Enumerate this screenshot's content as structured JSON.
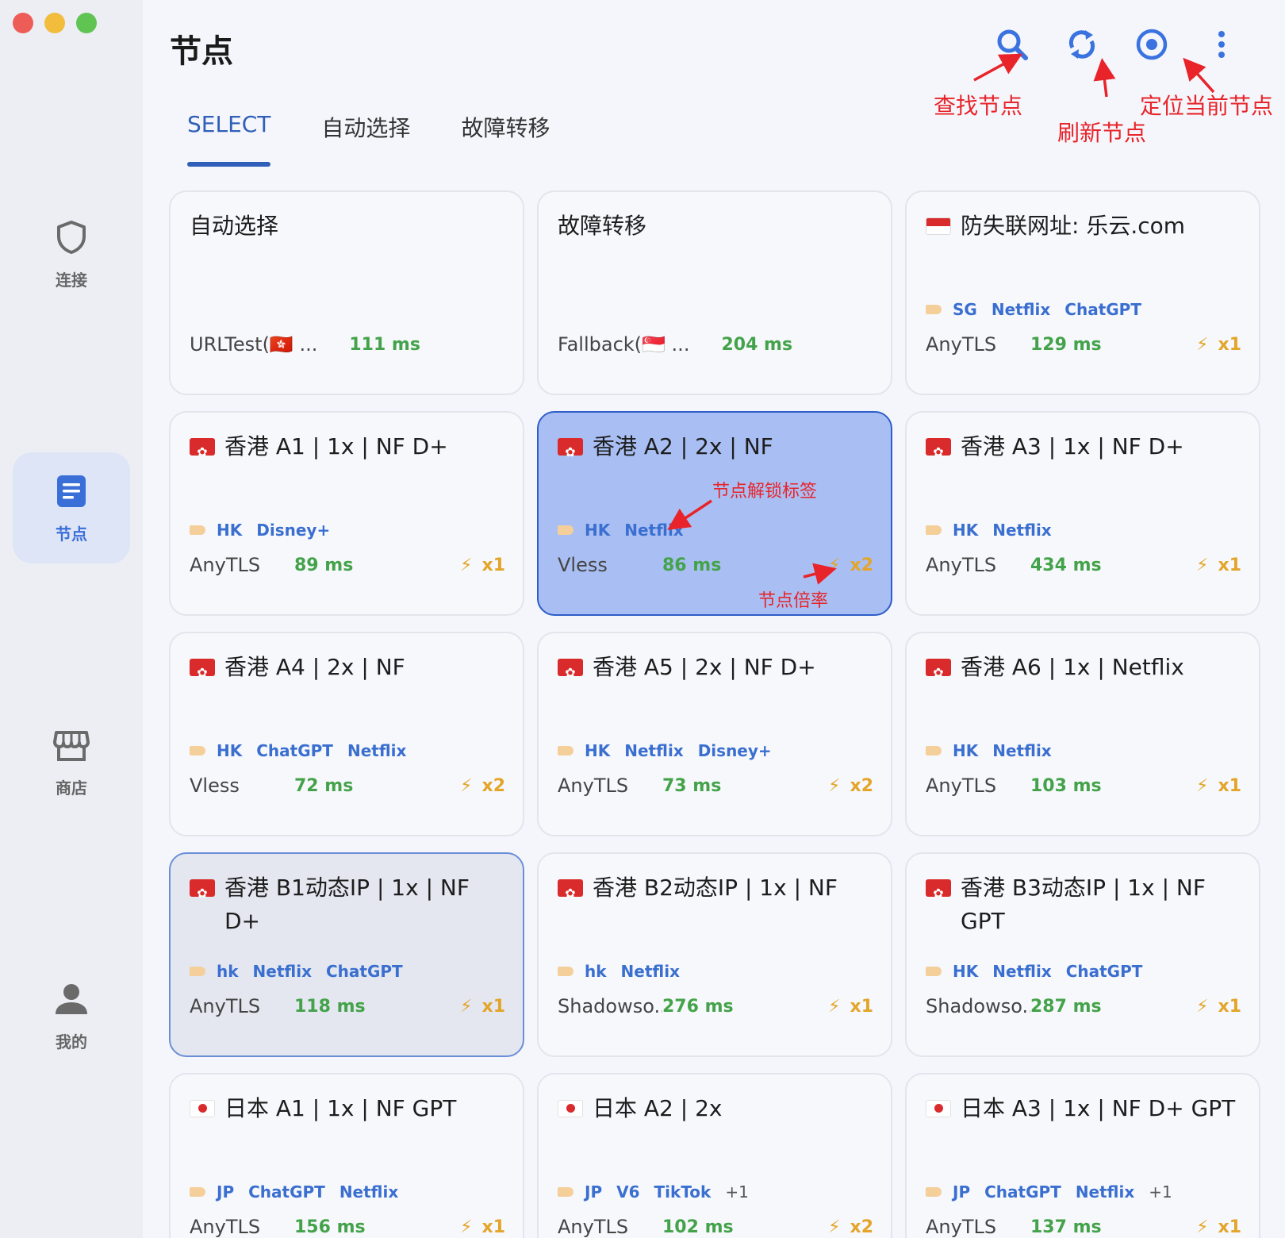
{
  "sidebar": {
    "items": [
      {
        "label": "连接",
        "icon": "shield-icon"
      },
      {
        "label": "节点",
        "icon": "document-list-icon"
      },
      {
        "label": "商店",
        "icon": "store-icon"
      },
      {
        "label": "我的",
        "icon": "user-icon"
      }
    ],
    "active_index": 1
  },
  "header": {
    "title": "节点",
    "tools": [
      {
        "icon": "search-icon"
      },
      {
        "icon": "refresh-icon"
      },
      {
        "icon": "locate-icon"
      },
      {
        "icon": "more-vertical-icon"
      }
    ]
  },
  "tabs": [
    {
      "label": "SELECT",
      "active": true
    },
    {
      "label": "自动选择",
      "active": false
    },
    {
      "label": "故障转移",
      "active": false
    }
  ],
  "annotations": {
    "search": "查找节点",
    "refresh": "刷新节点",
    "locate": "定位当前节点",
    "unlock_tags": "节点解锁标签",
    "multiplier": "节点倍率"
  },
  "colors": {
    "accent": "#2f5fb8",
    "selected_card": "#a9bff3",
    "delay_green": "#44a34a",
    "multiplier_orange": "#e3a52a",
    "annotation_red": "#e8242a"
  },
  "cards": {
    "auto": {
      "title": "自动选择",
      "sub": "URLTest(🇭🇰 ...",
      "delay": "111 ms"
    },
    "fallback": {
      "title": "故障转移",
      "sub": "Fallback(🇸🇬 ...",
      "delay": "204 ms"
    },
    "antilost": {
      "title": "防失联网址: 乐云.com",
      "tags": [
        "SG",
        "Netflix",
        "ChatGPT"
      ],
      "proto": "AnyTLS",
      "delay": "129 ms",
      "mult": "x1"
    },
    "hka1": {
      "title": "香港 A1 | 1x | NF D+",
      "tags": [
        "HK",
        "Disney+"
      ],
      "proto": "AnyTLS",
      "delay": "89 ms",
      "mult": "x1"
    },
    "hka2": {
      "title": "香港 A2 | 2x | NF",
      "tags": [
        "HK",
        "Netflix"
      ],
      "proto": "Vless",
      "delay": "86 ms",
      "mult": "x2"
    },
    "hka3": {
      "title": "香港 A3 | 1x  | NF D+",
      "tags": [
        "HK",
        "Netflix"
      ],
      "proto": "AnyTLS",
      "delay": "434 ms",
      "mult": "x1"
    },
    "hka4": {
      "title": "香港 A4 | 2x | NF",
      "tags": [
        "HK",
        "ChatGPT",
        "Netflix"
      ],
      "proto": "Vless",
      "delay": "72 ms",
      "mult": "x2"
    },
    "hka5": {
      "title": "香港 A5 | 2x | NF  D+",
      "tags": [
        "HK",
        "Netflix",
        "Disney+"
      ],
      "proto": "AnyTLS",
      "delay": "73 ms",
      "mult": "x2"
    },
    "hka6": {
      "title": "香港 A6 | 1x |  Netflix",
      "tags": [
        "HK",
        "Netflix"
      ],
      "proto": "AnyTLS",
      "delay": "103 ms",
      "mult": "x1"
    },
    "hkb1": {
      "title": "香港 B1动态IP | 1x | NF D+",
      "tags": [
        "hk",
        "Netflix",
        "ChatGPT"
      ],
      "proto": "AnyTLS",
      "delay": "118 ms",
      "mult": "x1"
    },
    "hkb2": {
      "title": "香港 B2动态IP | 1x | NF",
      "tags": [
        "hk",
        "Netflix"
      ],
      "proto": "Shadowso...",
      "delay": "276 ms",
      "mult": "x1"
    },
    "hkb3": {
      "title": "香港 B3动态IP | 1x | NF GPT",
      "tags": [
        "HK",
        "Netflix",
        "ChatGPT"
      ],
      "proto": "Shadowso...",
      "delay": "287 ms",
      "mult": "x1"
    },
    "jpa1": {
      "title": "日本 A1 | 1x  | NF GPT",
      "tags": [
        "JP",
        "ChatGPT",
        "Netflix"
      ],
      "proto": "AnyTLS",
      "delay": "156 ms",
      "mult": "x1"
    },
    "jpa2": {
      "title": "日本 A2 | 2x",
      "tags": [
        "JP",
        "V6",
        "TikTok"
      ],
      "extra": "+1",
      "proto": "AnyTLS",
      "delay": "102 ms",
      "mult": "x2"
    },
    "jpa3": {
      "title": "日本 A3 | 1x  | NF D+ GPT",
      "tags": [
        "JP",
        "ChatGPT",
        "Netflix"
      ],
      "extra": "+1",
      "proto": "AnyTLS",
      "delay": "137 ms",
      "mult": "x1"
    }
  }
}
